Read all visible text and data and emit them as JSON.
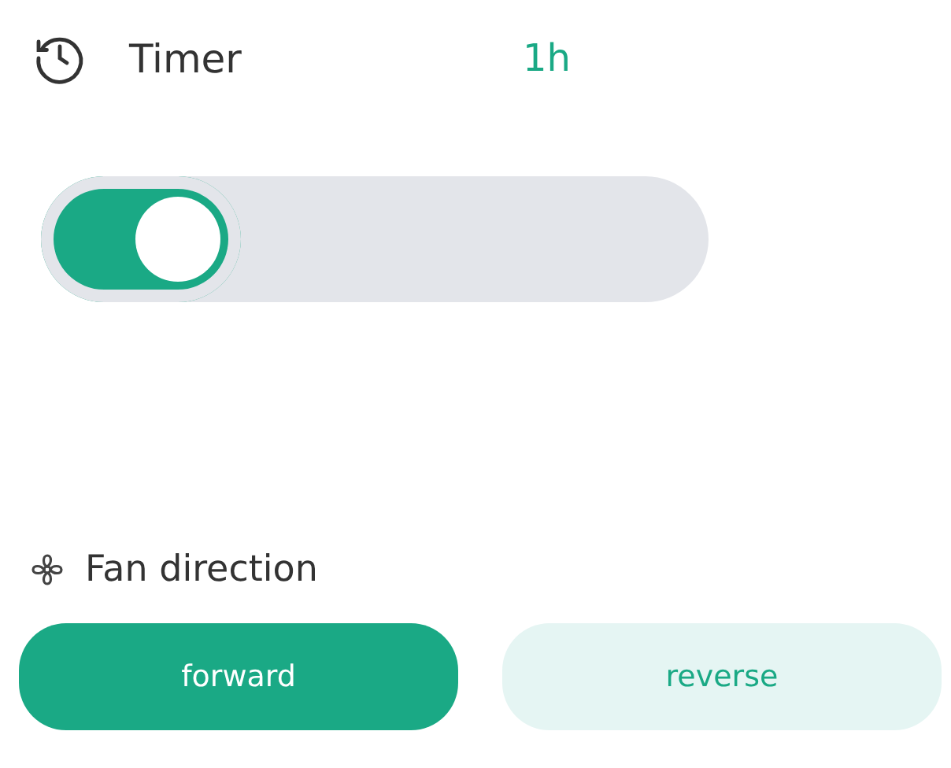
{
  "timer": {
    "label": "Timer",
    "value": "1h"
  },
  "fan_direction": {
    "label": "Fan direction",
    "options": [
      {
        "label": "forward",
        "selected": true
      },
      {
        "label": "reverse",
        "selected": false
      }
    ]
  }
}
